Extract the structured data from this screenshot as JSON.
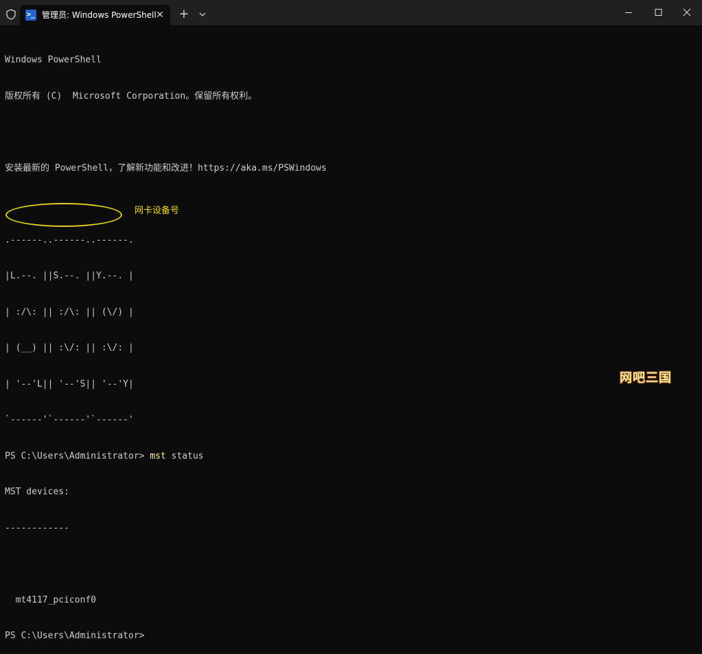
{
  "window": {
    "tab_title": "管理员: Windows PowerShell",
    "tab_icon_text": ">_",
    "close_tab_glyph": "✕",
    "new_tab_glyph": "+",
    "icons": {
      "shield": "shield-icon",
      "powershell": "powershell-icon",
      "dropdown": "chevron-down-icon",
      "minimize": "minimize-icon",
      "maximize": "maximize-icon",
      "close": "close-icon"
    }
  },
  "terminal": {
    "lines": [
      "Windows PowerShell",
      "版权所有 (C)  Microsoft Corporation。保留所有权利。",
      "",
      "安装最新的 PowerShell，了解新功能和改进！https://aka.ms/PSWindows",
      "",
      ".------..------..------.",
      "|L.--. ||S.--. ||Y.--. |",
      "| :/\\: || :/\\: || (\\/) |",
      "| (__) || :\\/: || :\\/: |",
      "| '--'L|| '--'S|| '--'Y|",
      "`------'`------'`------'"
    ],
    "prompt1": "PS C:\\Users\\Administrator> ",
    "command": "mst",
    "command_arg": " status",
    "output": [
      "MST devices:",
      "------------",
      "",
      "  mt4117_pciconf0"
    ],
    "prompt2": "PS C:\\Users\\Administrator>"
  },
  "annotation": {
    "label": "网卡设备号",
    "color": "#e6d21d"
  },
  "watermark": {
    "text": "网吧三国"
  },
  "colors": {
    "background": "#0c0c0c",
    "titlebar": "#202020",
    "text": "#cccccc",
    "command": "#f9f1a5"
  }
}
